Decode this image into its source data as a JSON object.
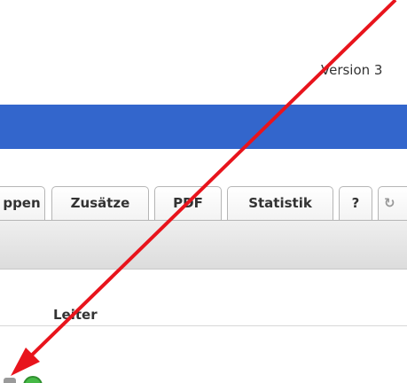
{
  "header": {
    "version_text": "Version 3"
  },
  "tabs": [
    {
      "label": "ppen"
    },
    {
      "label": "Zusätze"
    },
    {
      "label": "PDF"
    },
    {
      "label": "Statistik"
    },
    {
      "label": "?"
    },
    {
      "label": "↻"
    }
  ],
  "table": {
    "column_header": "Leiter"
  },
  "annotation": {
    "arrow_color": "#e8141c"
  },
  "colors": {
    "blue_bar": "#3366cc"
  },
  "icons": [
    "refresh-icon",
    "status-grey-icon",
    "status-green-icon"
  ]
}
